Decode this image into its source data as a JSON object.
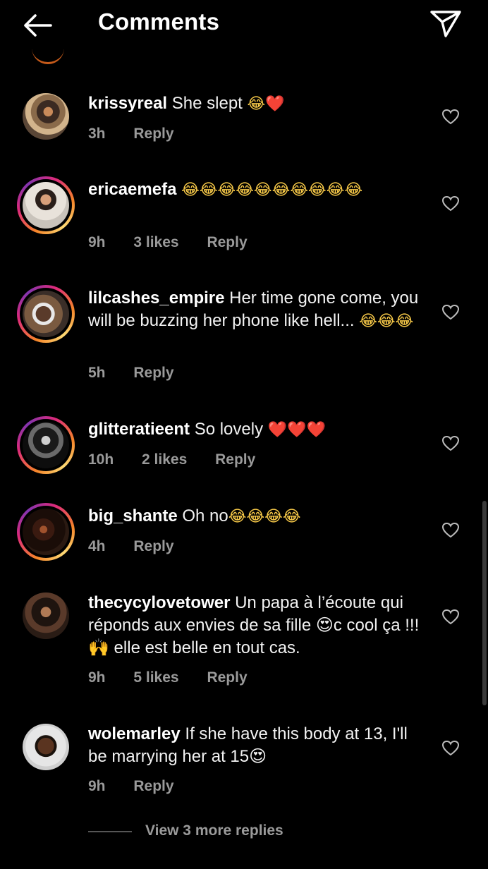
{
  "header": {
    "title": "Comments",
    "back_icon": "arrow-left-icon",
    "send_icon": "paper-plane-icon"
  },
  "comments": [
    {
      "username": "krissyreal",
      "text": "She slept",
      "emojis": "😂❤️",
      "time": "3h",
      "likes": "",
      "reply": "Reply",
      "story_ring": false
    },
    {
      "username": "ericaemefa",
      "text": "",
      "emojis": "😂😂😂😂😂😂😂😂😂😂",
      "time": "9h",
      "likes": "3 likes",
      "reply": "Reply",
      "story_ring": true
    },
    {
      "username": "lilcashes_empire",
      "text": "Her time gone come, you will be buzzing her phone like hell...",
      "emojis": "😂😂😂",
      "time": "5h",
      "likes": "",
      "reply": "Reply",
      "story_ring": true
    },
    {
      "username": "glitteratieent",
      "text": "So lovely",
      "emojis": "❤️❤️❤️",
      "time": "10h",
      "likes": "2 likes",
      "reply": "Reply",
      "story_ring": true
    },
    {
      "username": "big_shante",
      "text": "Oh no",
      "emojis": "😂😂😂😂",
      "time": "4h",
      "likes": "",
      "reply": "Reply",
      "story_ring": true
    },
    {
      "username": "thecycylovetower",
      "text": "Un papa à l’écoute qui réponds aux envies de sa fille 😍c cool ça !!!🙌 elle est belle en tout cas.",
      "emojis": "",
      "time": "9h",
      "likes": "5 likes",
      "reply": "Reply",
      "story_ring": false
    },
    {
      "username": "wolemarley",
      "text": "If she have this body at 13, I'll be marrying her at 15😍",
      "emojis": "",
      "time": "9h",
      "likes": "",
      "reply": "Reply",
      "story_ring": false
    }
  ],
  "view_more_replies": "View 3 more replies",
  "colors": {
    "background": "#000000",
    "meta_text": "#9a9a9a",
    "ring_start": "#f58529",
    "ring_mid": "#dd2a7b"
  }
}
